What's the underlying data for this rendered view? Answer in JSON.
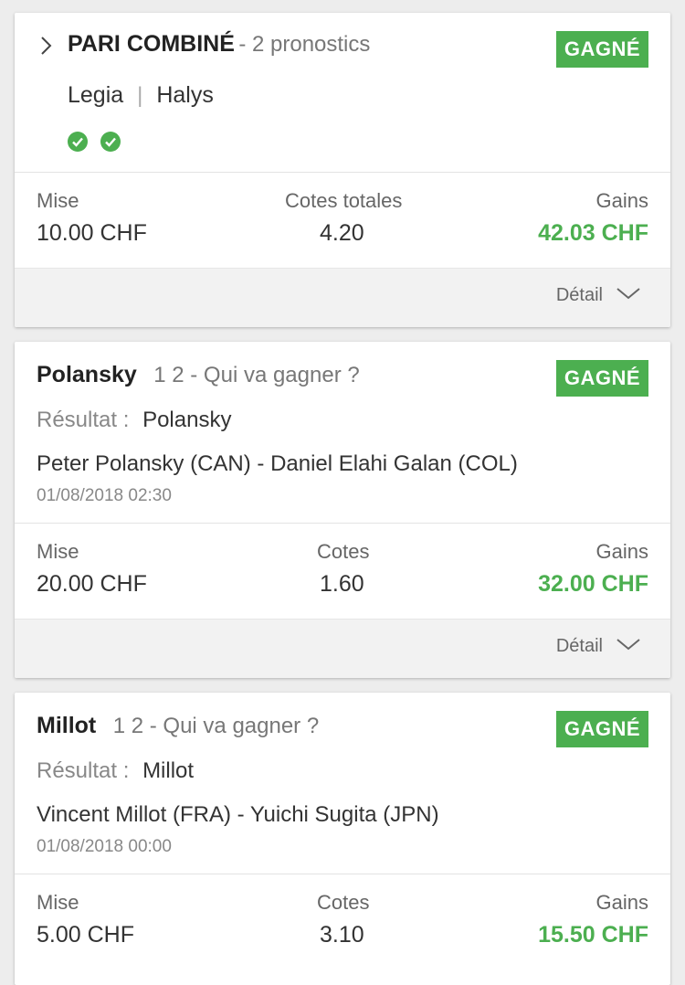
{
  "cards": [
    {
      "title": "PARI COMBINÉ",
      "subtitle": "- 2 pronostics",
      "status": "GAGNÉ",
      "teams": [
        "Legia",
        "Halys"
      ],
      "separator": "|",
      "stake_label": "Mise",
      "stake_value": "10.00 CHF",
      "odds_label": "Cotes totales",
      "odds_value": "4.20",
      "gain_label": "Gains",
      "gain_value": "42.03 CHF",
      "detail_label": "Détail"
    },
    {
      "title": "Polansky",
      "subtitle": "1 2 - Qui va gagner ?",
      "status": "GAGNÉ",
      "result_label": "Résultat :",
      "result_value": "Polansky",
      "match": "Peter Polansky (CAN) - Daniel Elahi Galan (COL)",
      "date": "01/08/2018 02:30",
      "stake_label": "Mise",
      "stake_value": "20.00 CHF",
      "odds_label": "Cotes",
      "odds_value": "1.60",
      "gain_label": "Gains",
      "gain_value": "32.00 CHF",
      "detail_label": "Détail"
    },
    {
      "title": "Millot",
      "subtitle": "1 2 - Qui va gagner ?",
      "status": "GAGNÉ",
      "result_label": "Résultat :",
      "result_value": "Millot",
      "match": "Vincent Millot (FRA) - Yuichi Sugita (JPN)",
      "date": "01/08/2018 00:00",
      "stake_label": "Mise",
      "stake_value": "5.00 CHF",
      "odds_label": "Cotes",
      "odds_value": "3.10",
      "gain_label": "Gains",
      "gain_value": "15.50 CHF"
    }
  ],
  "colors": {
    "accent": "#4caf50",
    "background": "#ededed"
  },
  "icons": {
    "expand": "chevron-right-icon",
    "won_pick": "check-circle-icon",
    "detail": "chevron-down-icon"
  }
}
